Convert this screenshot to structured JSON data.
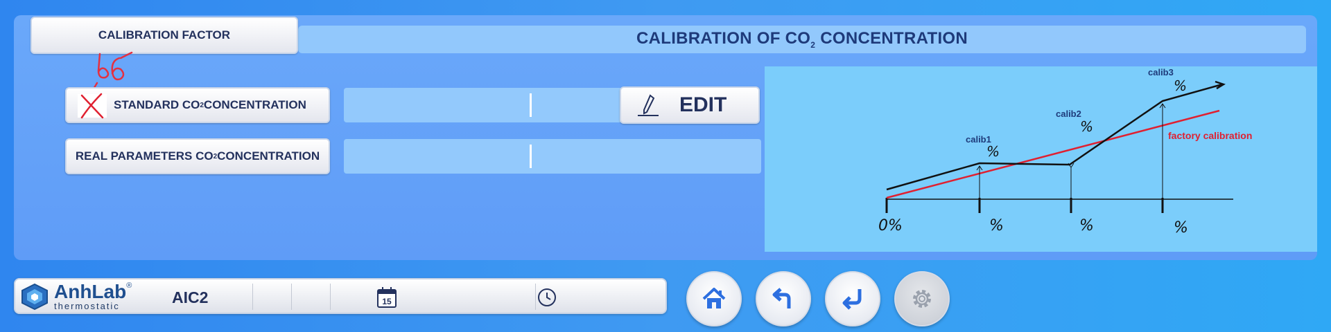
{
  "header": {
    "title_prefix": "CALIBRATION OF CO",
    "title_sub": "2",
    "title_suffix": " CONCENTRATION",
    "tab_label": "CALIBRATION FACTOR"
  },
  "annotation_text": "b6",
  "rows": [
    {
      "label_prefix": "STANDARD CO",
      "label_sub": "2",
      "label_suffix": " CONCENTRATION"
    },
    {
      "label_prefix": "REAL PARAMETERS CO",
      "label_sub": "2",
      "label_suffix": " CONCENTRATION"
    }
  ],
  "edit_button": {
    "label": "EDIT",
    "icon": "pen-icon"
  },
  "graph": {
    "calib_labels": [
      "calib1",
      "calib2",
      "calib3"
    ],
    "factory_label": "factory calibration",
    "axis_labels": [
      "0%",
      "%",
      "%",
      "%"
    ],
    "point_labels": [
      "%",
      "%",
      "%"
    ],
    "colors": {
      "measured": "#111111",
      "factory": "#e02030",
      "text": "#1e3a7a"
    }
  },
  "status_bar": {
    "logo_name": "AnhLab",
    "logo_reg": "®",
    "logo_sub": "thermostatic",
    "device": "AIC2",
    "calendar_day": "15",
    "date": "",
    "time": ""
  },
  "nav_buttons": [
    {
      "name": "home",
      "icon": "home-icon"
    },
    {
      "name": "back",
      "icon": "back-arrow-icon"
    },
    {
      "name": "enter",
      "icon": "enter-icon"
    },
    {
      "name": "settings",
      "icon": "gear-icon",
      "disabled": true
    }
  ],
  "colors": {
    "accent": "#23315d",
    "panel": "#6aa8fa",
    "graph_bg": "#7bcdfb"
  }
}
